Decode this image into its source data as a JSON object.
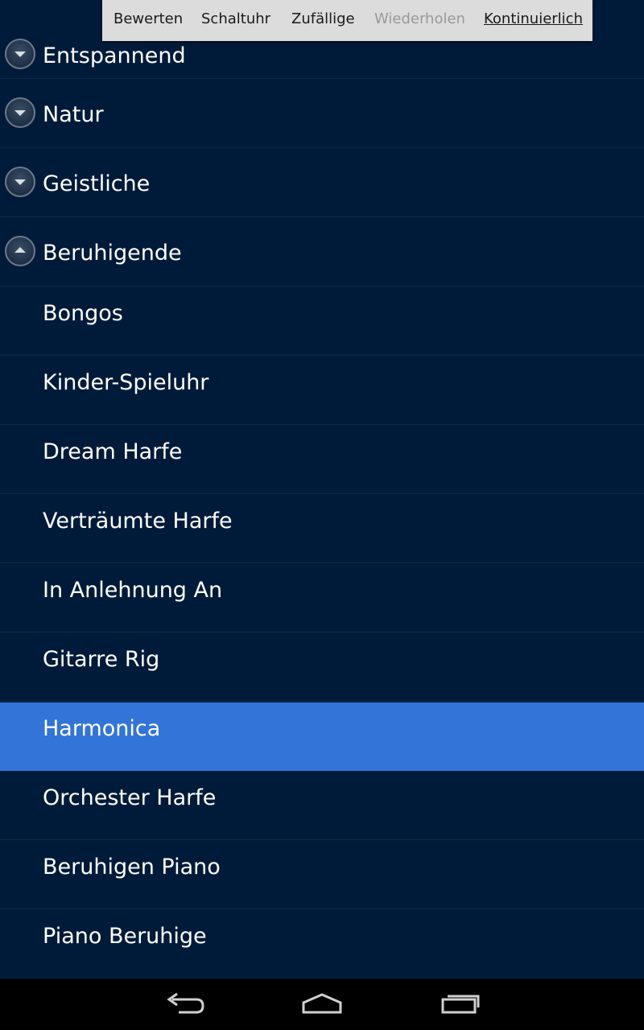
{
  "menu": {
    "items": [
      {
        "label": "Bewerten",
        "state": "normal"
      },
      {
        "label": "Schaltuhr",
        "state": "normal"
      },
      {
        "label": "Zufällige",
        "state": "normal"
      },
      {
        "label": "Wiederholen",
        "state": "disabled"
      },
      {
        "label": "Kontinuierlich",
        "state": "active"
      }
    ]
  },
  "list": {
    "groups": [
      {
        "label": "Entspannend",
        "icon": "expand-down-icon"
      },
      {
        "label": "Natur",
        "icon": "expand-down-icon"
      },
      {
        "label": "Geistliche",
        "icon": "expand-down-icon"
      },
      {
        "label": "Beruhigende",
        "icon": "collapse-up-icon"
      }
    ],
    "children": [
      {
        "label": "Bongos"
      },
      {
        "label": "Kinder-Spieluhr"
      },
      {
        "label": "Dream Harfe"
      },
      {
        "label": "Verträumte Harfe"
      },
      {
        "label": "In Anlehnung An"
      },
      {
        "label": "Gitarre Rig"
      },
      {
        "label": "Harmonica",
        "selected": true
      },
      {
        "label": "Orchester Harfe"
      },
      {
        "label": "Beruhigen Piano"
      },
      {
        "label": "Piano Beruhige"
      }
    ]
  },
  "colors": {
    "background": "#001b3a",
    "selected": "#3274d8",
    "menu_bg": "#dcdcdc"
  },
  "navbar": {
    "buttons": [
      "back-icon",
      "home-icon",
      "recent-apps-icon"
    ]
  }
}
